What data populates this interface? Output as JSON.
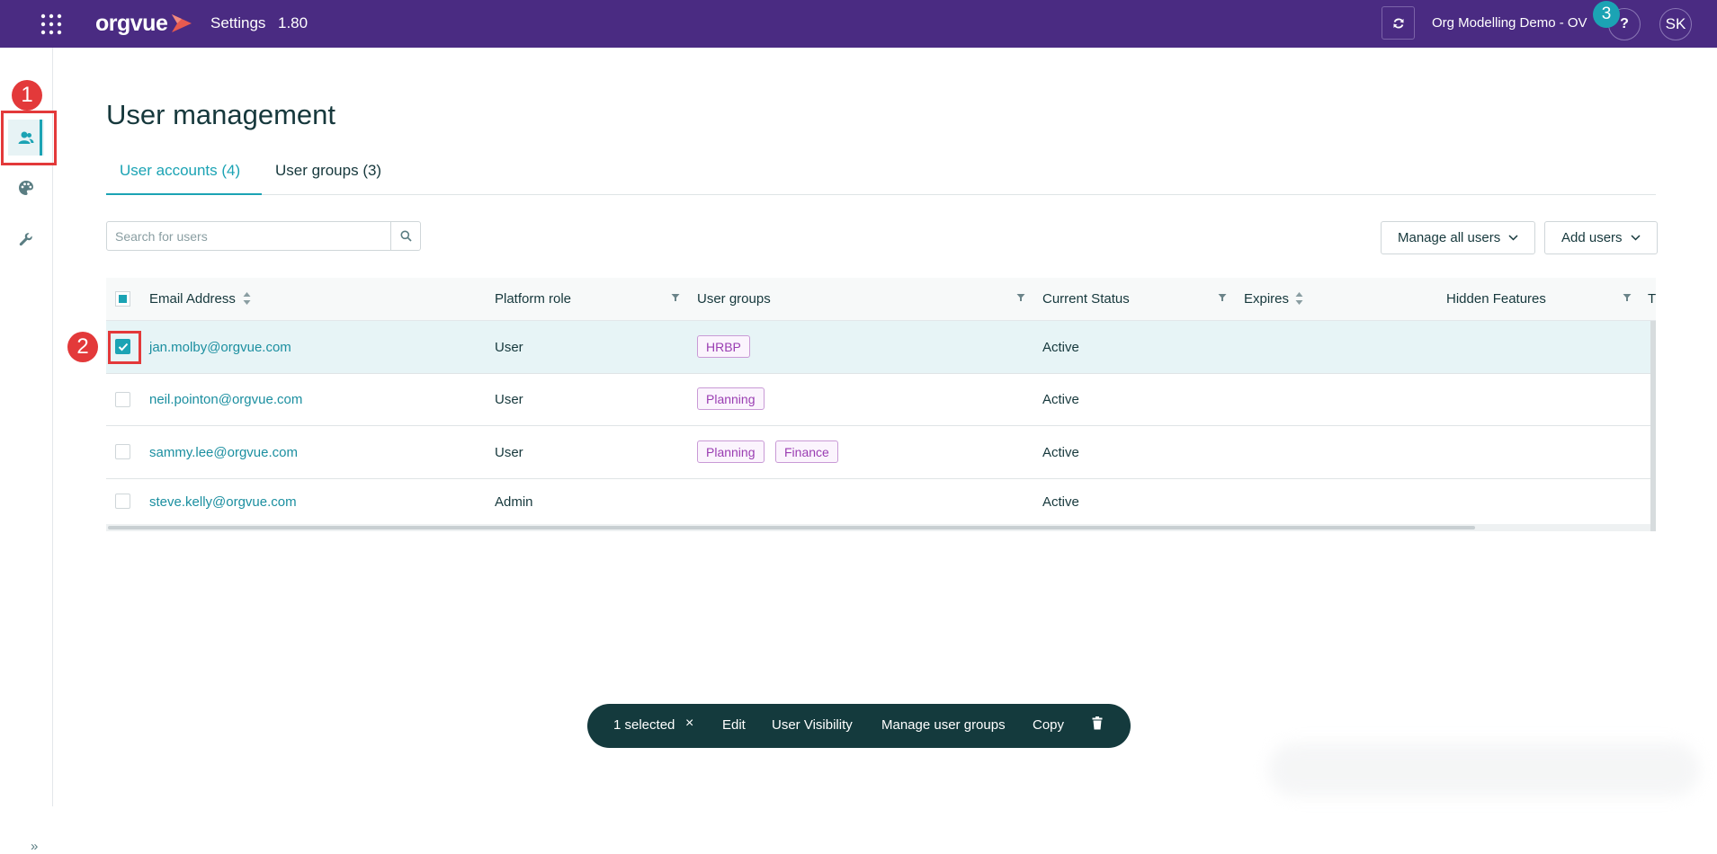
{
  "topbar": {
    "app_name": "orgvue",
    "title": "Settings",
    "version": "1.80",
    "workspace": "Org Modelling Demo - OV",
    "help_label": "?",
    "avatar_initials": "SK",
    "bg_color": "#4a2b82"
  },
  "annotations": {
    "step1": "1",
    "step2": "2",
    "step3": "3"
  },
  "sidebar": {
    "items": [
      {
        "icon": "users-icon",
        "active": true
      },
      {
        "icon": "palette-icon",
        "active": false
      },
      {
        "icon": "wrench-icon",
        "active": false
      }
    ],
    "collapse_label": "»"
  },
  "page": {
    "title": "User management",
    "tabs": [
      {
        "label": "User accounts (4)",
        "active": true
      },
      {
        "label": "User groups (3)",
        "active": false
      }
    ]
  },
  "toolbar": {
    "search_placeholder": "Search for users",
    "manage_all_users": "Manage all users",
    "add_users": "Add users"
  },
  "table": {
    "columns": [
      "Email Address",
      "Platform role",
      "User groups",
      "Current Status",
      "Expires",
      "Hidden Features",
      "T"
    ],
    "rows": [
      {
        "email": "jan.molby@orgvue.com",
        "role": "User",
        "groups": [
          "HRBP"
        ],
        "status": "Active",
        "selected": true
      },
      {
        "email": "neil.pointon@orgvue.com",
        "role": "User",
        "groups": [
          "Planning"
        ],
        "status": "Active",
        "selected": false
      },
      {
        "email": "sammy.lee@orgvue.com",
        "role": "User",
        "groups": [
          "Planning",
          "Finance"
        ],
        "status": "Active",
        "selected": false
      },
      {
        "email": "steve.kelly@orgvue.com",
        "role": "Admin",
        "groups": [],
        "status": "Active",
        "selected": false
      }
    ]
  },
  "action_bar": {
    "selected": "1 selected",
    "clear": "×",
    "edit": "Edit",
    "visibility": "User Visibility",
    "manage_groups": "Manage user groups",
    "copy": "Copy"
  },
  "colors": {
    "accent": "#1ba3b4",
    "annotation": "#e3393a",
    "tag_border": "#c99ad6",
    "tag_text": "#9a3db2"
  }
}
